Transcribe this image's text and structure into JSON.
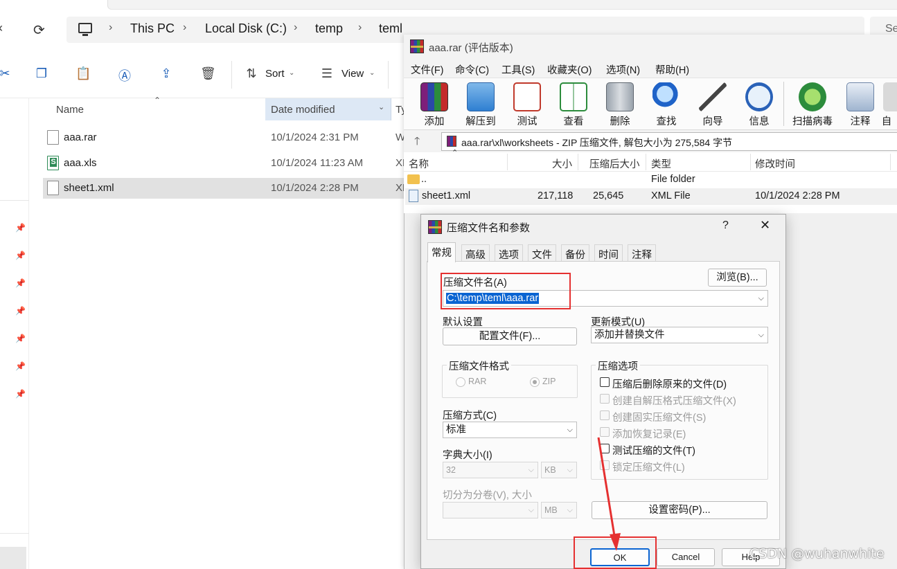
{
  "explorer": {
    "breadcrumb": [
      "This PC",
      "Local Disk (C:)",
      "temp",
      "teml"
    ],
    "search_placeholder": "Se",
    "toolbar": {
      "sort_label": "Sort",
      "view_label": "View"
    },
    "columns": {
      "name": "Name",
      "date": "Date modified",
      "type": "Ty"
    },
    "files": [
      {
        "name": "aaa.rar",
        "date": "10/1/2024 2:31 PM",
        "type": "W"
      },
      {
        "name": "aaa.xls",
        "date": "10/1/2024 11:23 AM",
        "type": "XL"
      },
      {
        "name": "sheet1.xml",
        "date": "10/1/2024 2:28 PM",
        "type": "XL"
      }
    ]
  },
  "winrar": {
    "title": "aaa.rar (评估版本)",
    "menu": [
      "文件(F)",
      "命令(C)",
      "工具(S)",
      "收藏夹(O)",
      "选项(N)",
      "帮助(H)"
    ],
    "tools": [
      {
        "label": "添加",
        "icon": "add-archive-icon"
      },
      {
        "label": "解压到",
        "icon": "extract-folder-icon"
      },
      {
        "label": "测试",
        "icon": "test-clipboard-icon"
      },
      {
        "label": "查看",
        "icon": "view-book-icon"
      },
      {
        "label": "删除",
        "icon": "trash-bin-icon"
      },
      {
        "label": "查找",
        "icon": "magnifier-icon"
      },
      {
        "label": "向导",
        "icon": "magic-wand-icon"
      },
      {
        "label": "信息",
        "icon": "info-icon"
      },
      {
        "label": "扫描病毒",
        "icon": "virus-scan-icon"
      },
      {
        "label": "注释",
        "icon": "comment-icon"
      },
      {
        "label": "自",
        "icon": "sfx-icon"
      }
    ],
    "path": "aaa.rar\\xl\\worksheets - ZIP 压缩文件, 解包大小为 275,584 字节",
    "list_columns": {
      "name": "名称",
      "size": "大小",
      "packed": "压缩后大小",
      "type": "类型",
      "modified": "修改时间"
    },
    "rows": [
      {
        "name": "..",
        "size": "",
        "packed": "",
        "type": "File folder",
        "modified": ""
      },
      {
        "name": "sheet1.xml",
        "size": "217,118",
        "packed": "25,645",
        "type": "XML File",
        "modified": "10/1/2024 2:28 PM"
      }
    ]
  },
  "dialog": {
    "title": "压缩文件名和参数",
    "help": "?",
    "close": "✕",
    "tabs": [
      "常规",
      "高级",
      "选项",
      "文件",
      "备份",
      "时间",
      "注释"
    ],
    "archive_name_label": "压缩文件名(A)",
    "archive_name_value": "C:\\temp\\teml\\aaa.rar",
    "browse_label": "浏览(B)...",
    "default_settings_label": "默认设置",
    "profiles_label": "配置文件(F)...",
    "update_mode_label": "更新模式(U)",
    "update_mode_value": "添加并替换文件",
    "format_group": "压缩文件格式",
    "format_rar": "RAR",
    "format_zip": "ZIP",
    "method_label": "压缩方式(C)",
    "method_value": "标准",
    "dict_label": "字典大小(I)",
    "dict_value": "32",
    "dict_unit": "KB",
    "split_label": "切分为分卷(V), 大小",
    "split_value": "",
    "split_unit": "MB",
    "options_group": "压缩选项",
    "options": [
      {
        "label": "压缩后删除原来的文件(D)",
        "enabled": true
      },
      {
        "label": "创建自解压格式压缩文件(X)",
        "enabled": false
      },
      {
        "label": "创建固实压缩文件(S)",
        "enabled": false
      },
      {
        "label": "添加恢复记录(E)",
        "enabled": false
      },
      {
        "label": "测试压缩的文件(T)",
        "enabled": true
      },
      {
        "label": "锁定压缩文件(L)",
        "enabled": false
      }
    ],
    "password_label": "设置密码(P)...",
    "ok_label": "OK",
    "cancel_label": "Cancel",
    "help_label": "Help"
  },
  "watermark": "CSDN @wuhanwhite",
  "colors": {
    "annotation_red": "#e53030",
    "selection_blue": "#0a64d2"
  }
}
